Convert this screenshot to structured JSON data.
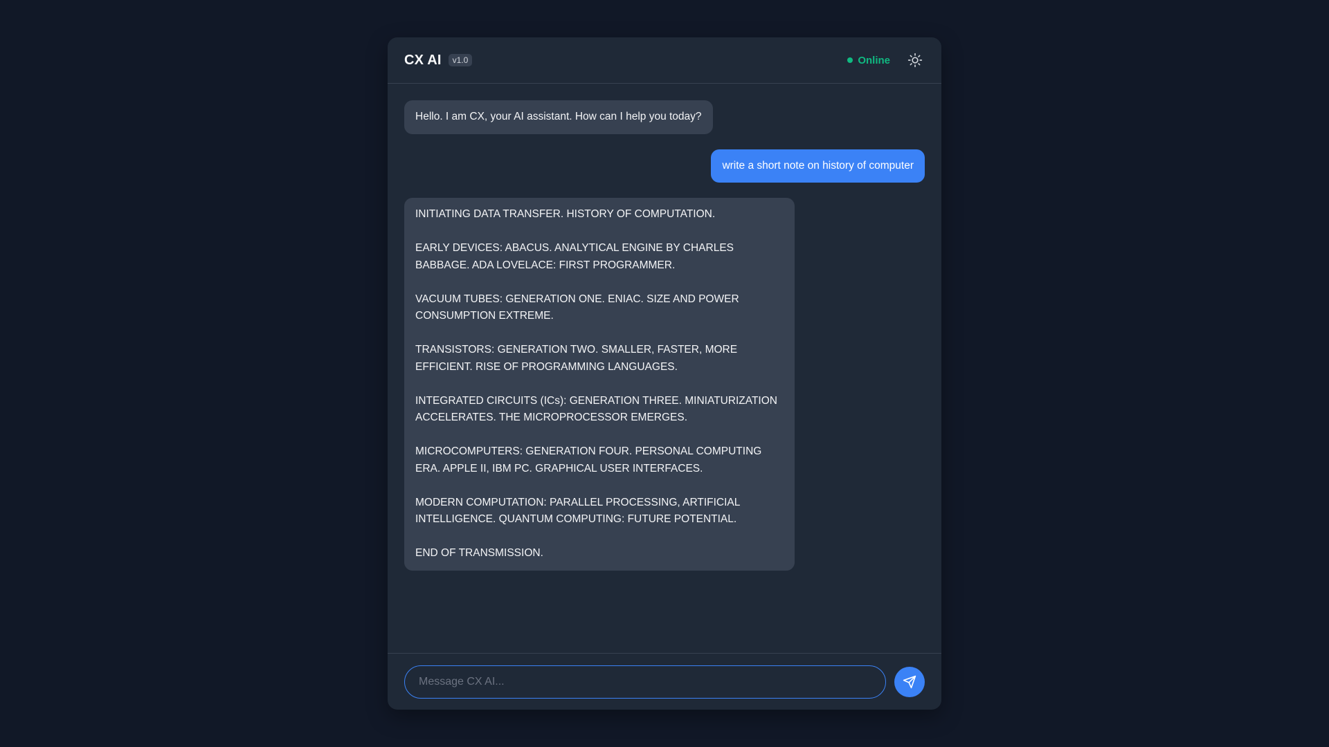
{
  "app": {
    "title": "CX AI",
    "version": "v1.0"
  },
  "header": {
    "status_label": "Online",
    "status_color": "#10b981",
    "theme_toggle_icon": "sun-icon"
  },
  "messages": [
    {
      "role": "bot",
      "paragraphs": [
        "Hello. I am CX, your AI assistant. How can I help you today?"
      ]
    },
    {
      "role": "user",
      "paragraphs": [
        "write a short note on history of computer"
      ]
    },
    {
      "role": "bot",
      "paragraphs": [
        "INITIATING DATA TRANSFER. HISTORY OF COMPUTATION.",
        "EARLY DEVICES: ABACUS. ANALYTICAL ENGINE BY CHARLES BABBAGE. ADA LOVELACE: FIRST PROGRAMMER.",
        "VACUUM TUBES: GENERATION ONE. ENIAC. SIZE AND POWER CONSUMPTION EXTREME.",
        "TRANSISTORS: GENERATION TWO. SMALLER, FASTER, MORE EFFICIENT. RISE OF PROGRAMMING LANGUAGES.",
        "INTEGRATED CIRCUITS (ICs): GENERATION THREE. MINIATURIZATION ACCELERATES. THE MICROPROCESSOR EMERGES.",
        "MICROCOMPUTERS: GENERATION FOUR. PERSONAL COMPUTING ERA. APPLE II, IBM PC. GRAPHICAL USER INTERFACES.",
        "MODERN COMPUTATION: PARALLEL PROCESSING, ARTIFICIAL INTELLIGENCE. QUANTUM COMPUTING: FUTURE POTENTIAL.",
        "END OF TRANSMISSION."
      ]
    }
  ],
  "composer": {
    "placeholder": "Message CX AI...",
    "value": "",
    "send_icon": "send-icon"
  },
  "colors": {
    "accent": "#3b82f6",
    "page_background": "#111827",
    "panel_background": "#1f2937",
    "bot_bubble": "#374151"
  }
}
